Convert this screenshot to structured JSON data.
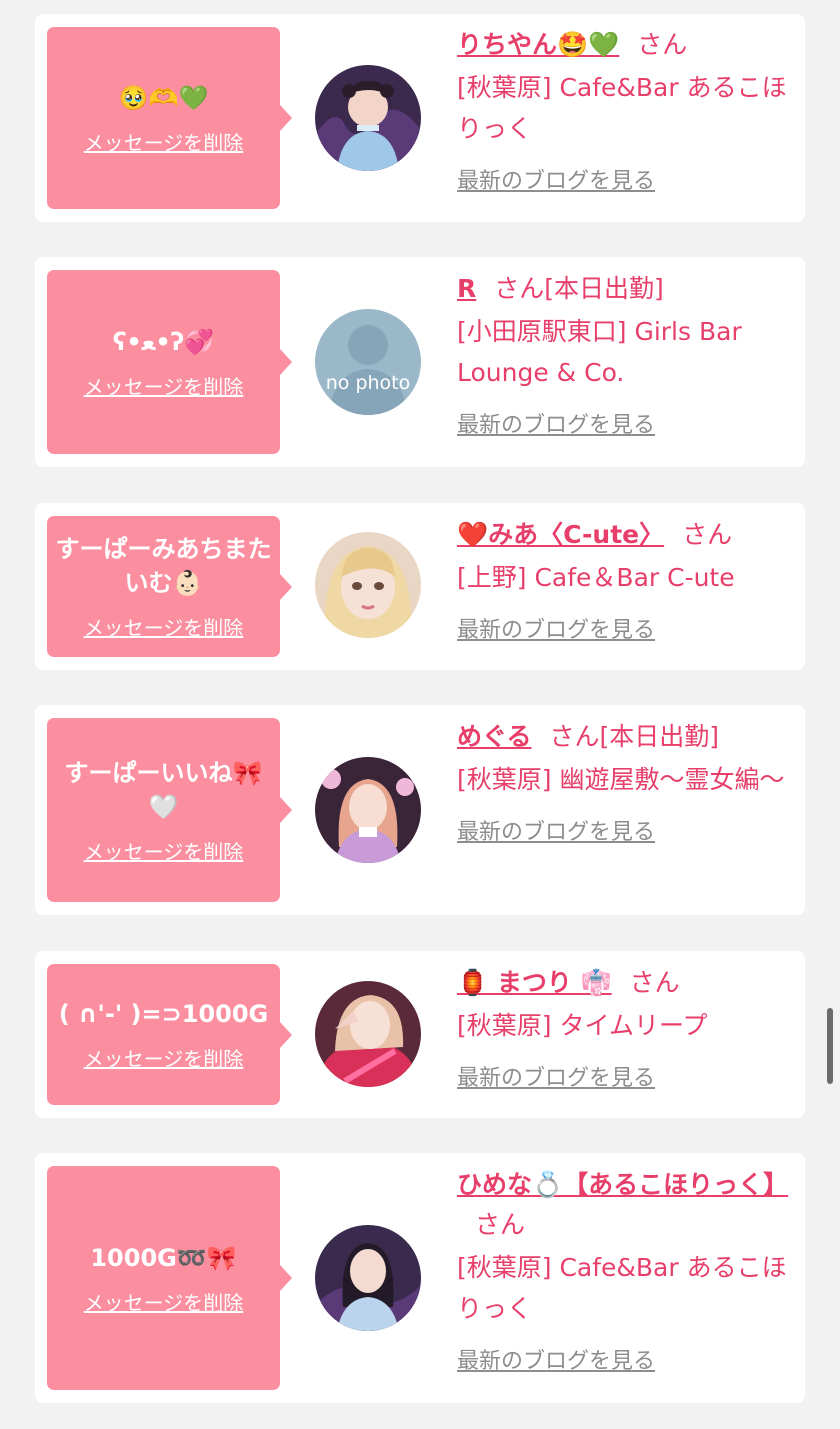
{
  "delete_label": "メッセージを削除",
  "blog_label": "最新のブログを見る",
  "san_label": "さん",
  "colors": {
    "accent": "#e73f6a",
    "bubble": "#fb8fa0",
    "background": "#f2f2f2"
  },
  "items": [
    {
      "message": "🥹🫶💚",
      "name": "りちやん🤩💚",
      "status": "",
      "shop": "[秋葉原] Cafe&Bar あるこほりっく",
      "avatar_icon": "girl-portrait-icon"
    },
    {
      "message": "ʕ•ﻌ•ʔ💞",
      "name": "R",
      "status": "[本日出勤]",
      "shop": "[小田原駅東口] Girls Bar Lounge & Co.",
      "avatar_icon": "no-photo-placeholder-icon",
      "avatar_text": "no photo"
    },
    {
      "message": "すーぱーみあちまたいむ👶🏻",
      "name": "❤️みあ〈C-ute〉",
      "status": "",
      "shop": "[上野] Cafe＆Bar C-ute",
      "avatar_icon": "blonde-girl-portrait-icon"
    },
    {
      "message": "すーぱーいいね🎀🤍",
      "name": "めぐる",
      "status": "[本日出勤]",
      "shop": "[秋葉原] 幽遊屋敷〜霊女編〜",
      "avatar_icon": "pink-hair-girl-portrait-icon"
    },
    {
      "message": "( ∩'-' )=⊃1000G",
      "name": "🏮 まつり 👘",
      "status": "",
      "shop": "[秋葉原] タイムリープ",
      "avatar_icon": "red-outfit-girl-portrait-icon"
    },
    {
      "message": "1000G➿🎀",
      "name": "ひめな💍【あるこほりっく】",
      "status": "",
      "shop": "[秋葉原] Cafe&Bar あるこほりっく",
      "avatar_icon": "dark-hair-girl-portrait-icon"
    }
  ]
}
